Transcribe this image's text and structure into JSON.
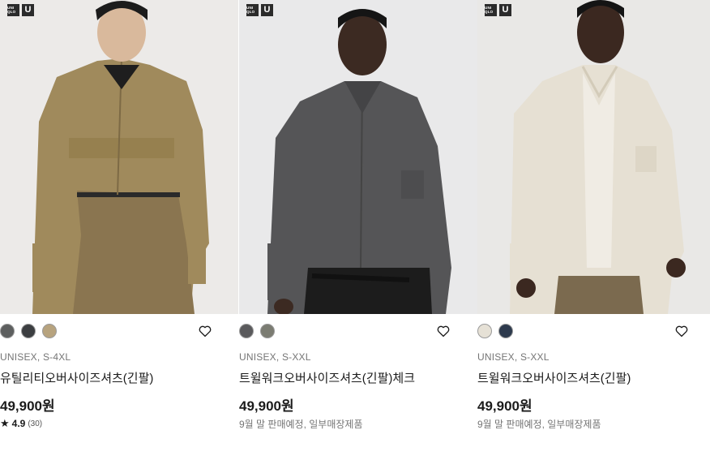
{
  "brand": {
    "logo_text_1": "UNI QLO",
    "logo_text_2": "U"
  },
  "colors": {
    "text": "#1b1b1b",
    "muted": "#757575"
  },
  "products": [
    {
      "swatches": [
        "#5d5f5f",
        "#3c3e41",
        "#b7a37e"
      ],
      "gender_size": "UNISEX, S-4XL",
      "name": "유틸리티오버사이즈셔츠(긴팔)",
      "price": "49,900원",
      "rating": {
        "score": "4.9",
        "count": "(30)"
      },
      "note": ""
    },
    {
      "swatches": [
        "#5a5a5c",
        "#7b7c72"
      ],
      "gender_size": "UNISEX, S-XXL",
      "name": "트윌워크오버사이즈셔츠(긴팔)체크",
      "price": "49,900원",
      "note": "9월 말 판매예정, 일부매장제품"
    },
    {
      "swatches": [
        "#e6e1d6",
        "#2d3a4d"
      ],
      "gender_size": "UNISEX, S-XXL",
      "name": "트윌워크오버사이즈셔츠(긴팔)",
      "price": "49,900원",
      "note": "9월 말 판매예정, 일부매장제품"
    }
  ]
}
